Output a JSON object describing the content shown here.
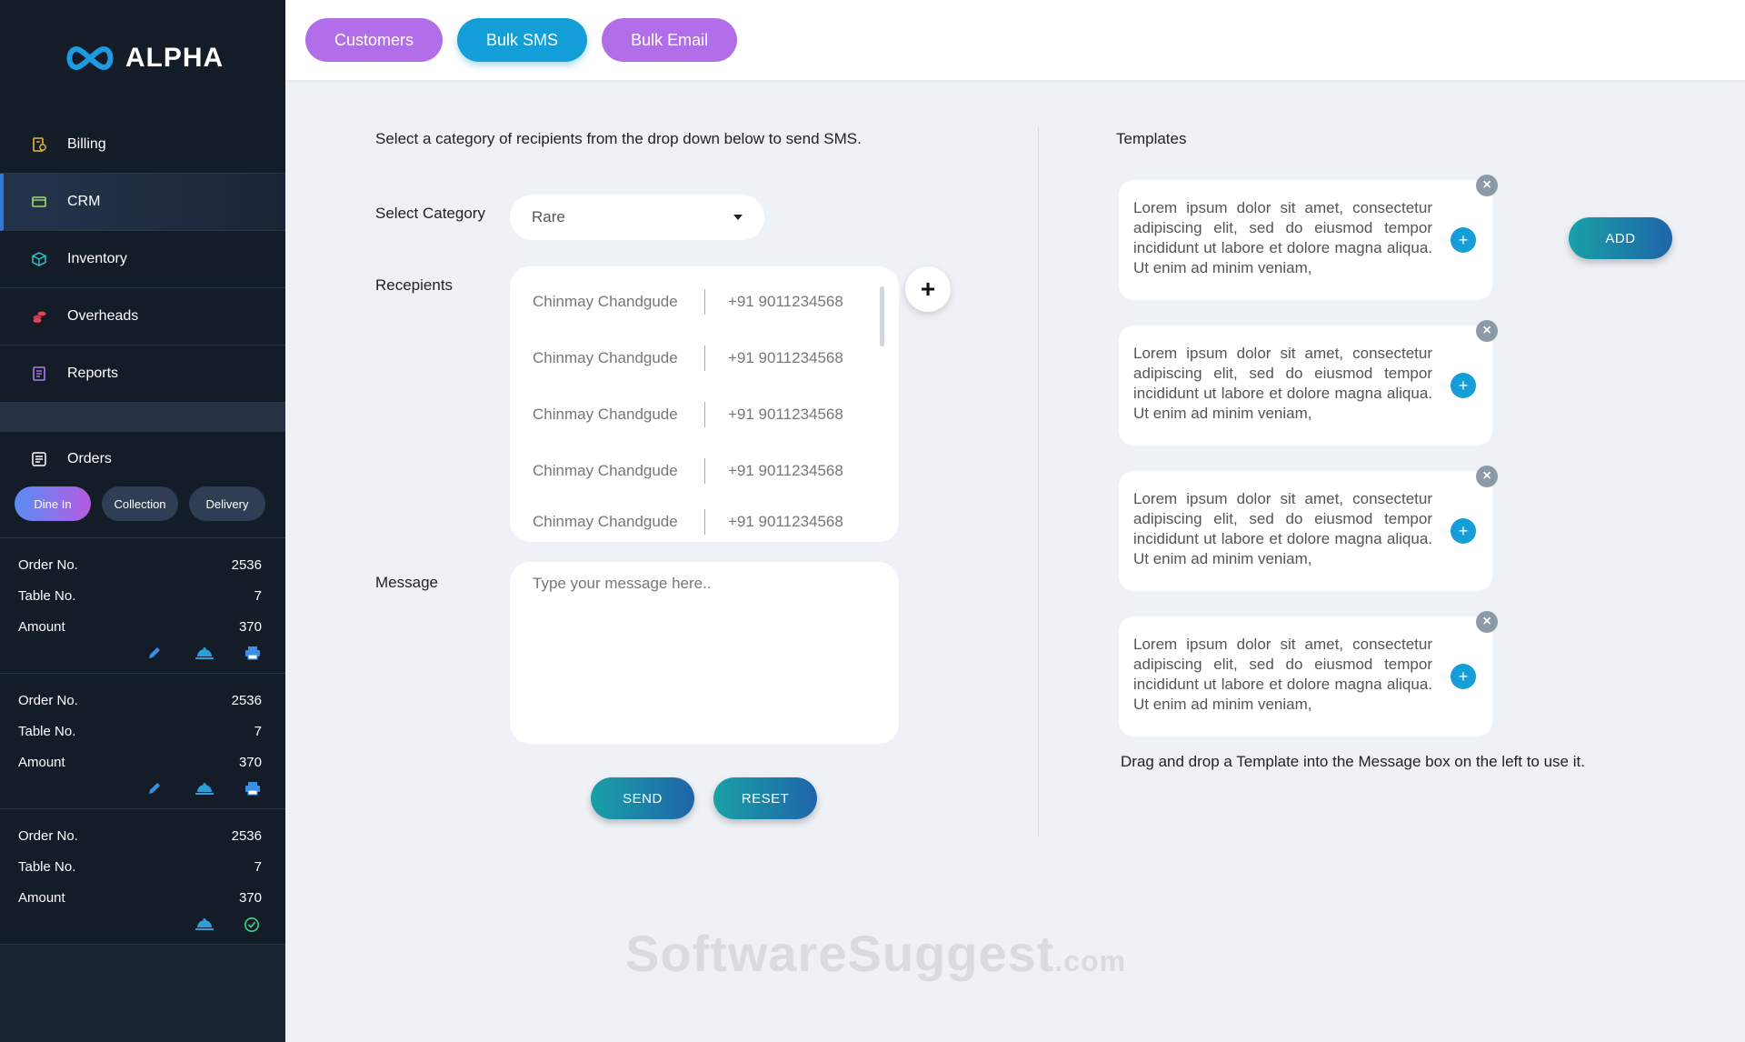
{
  "brand": {
    "name": "ALPHA",
    "accent": "#139ed8"
  },
  "sidebar": {
    "items": [
      {
        "label": "Billing",
        "icon": "receipt-icon"
      },
      {
        "label": "CRM",
        "icon": "window-icon",
        "active": true
      },
      {
        "label": "Inventory",
        "icon": "box-icon"
      },
      {
        "label": "Overheads",
        "icon": "coins-icon"
      },
      {
        "label": "Reports",
        "icon": "report-icon"
      }
    ],
    "orders": {
      "title": "Orders",
      "tabs": [
        "Dine In",
        "Collection",
        "Delivery"
      ],
      "active_tab": "Dine In",
      "labels": {
        "order_no": "Order No.",
        "table_no": "Table No.",
        "amount": "Amount"
      },
      "cards": [
        {
          "order_no": "2536",
          "table_no": "7",
          "amount": "370",
          "actions": [
            "edit-icon",
            "serving-bell-icon",
            "print-icon"
          ]
        },
        {
          "order_no": "2536",
          "table_no": "7",
          "amount": "370",
          "actions": [
            "edit-icon",
            "serving-bell-icon",
            "print-icon"
          ]
        },
        {
          "order_no": "2536",
          "table_no": "7",
          "amount": "370",
          "actions": [
            "serving-bell-icon",
            "check-circle-icon"
          ]
        }
      ]
    }
  },
  "topbar": {
    "tabs": [
      {
        "label": "Customers"
      },
      {
        "label": "Bulk SMS",
        "active": true
      },
      {
        "label": "Bulk Email"
      }
    ]
  },
  "sms": {
    "instruction": "Select a category of recipients from the drop down below to send SMS.",
    "category_label": "Select Category",
    "category_value": "Rare",
    "recipients_label": "Recepients",
    "recipients": [
      {
        "name": "Chinmay Chandgude",
        "phone": "+91 9011234568"
      },
      {
        "name": "Chinmay Chandgude",
        "phone": "+91 9011234568"
      },
      {
        "name": "Chinmay Chandgude",
        "phone": "+91 9011234568"
      },
      {
        "name": "Chinmay Chandgude",
        "phone": "+91 9011234568"
      },
      {
        "name": "Chinmay Chandgude",
        "phone": "+91 9011234568"
      }
    ],
    "message_label": "Message",
    "message_placeholder": "Type your message here..",
    "send_label": "SEND",
    "reset_label": "RESET"
  },
  "templates": {
    "title": "Templates",
    "items": [
      "Lorem ipsum dolor sit amet, consectetur adipiscing elit, sed do eiusmod tempor incididunt ut labore et dolore magna aliqua. Ut enim ad minim veniam,",
      "Lorem ipsum dolor sit amet, consectetur adipiscing elit, sed do eiusmod tempor incididunt ut labore et dolore magna aliqua. Ut enim ad minim veniam,",
      "Lorem ipsum dolor sit amet, consectetur adipiscing elit, sed do eiusmod tempor incididunt ut labore et dolore magna aliqua. Ut enim ad minim veniam,",
      "Lorem ipsum dolor sit amet, consectetur adipiscing elit, sed do eiusmod tempor incididunt ut labore et dolore magna aliqua. Ut enim ad minim veniam,"
    ],
    "add_label": "ADD",
    "hint": "Drag and drop a Template into the Message box on the left to use it."
  },
  "watermark": {
    "main": "SoftwareSuggest",
    "suffix": ".com"
  }
}
